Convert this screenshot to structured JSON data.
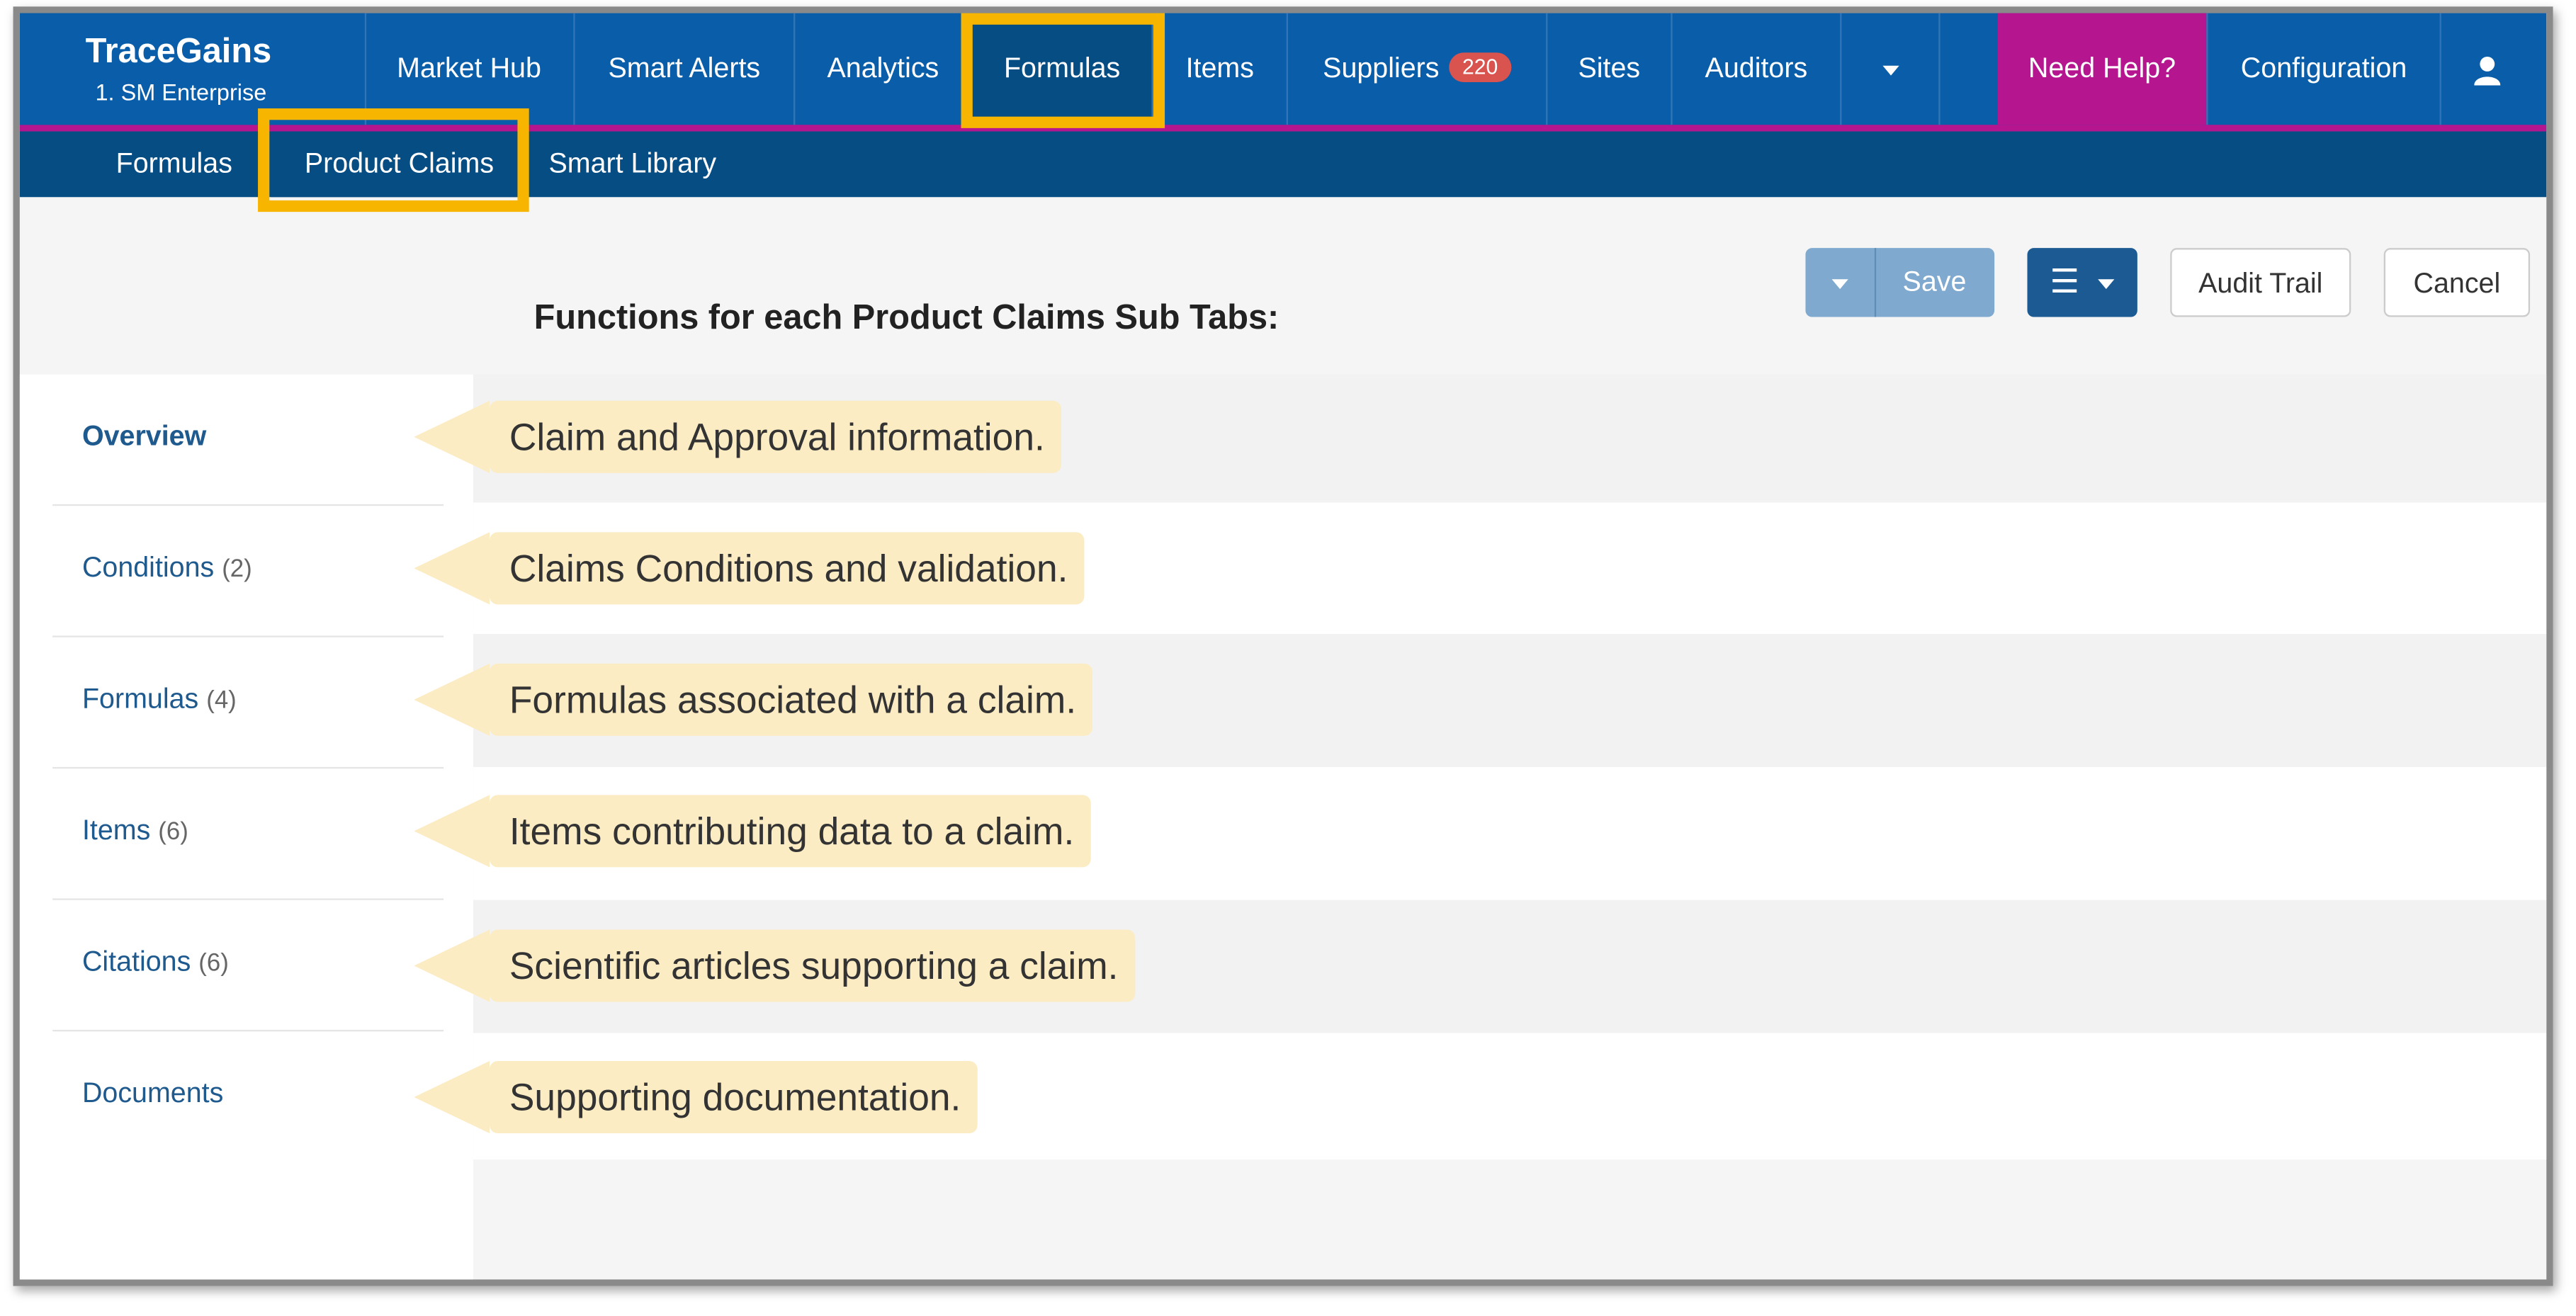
{
  "brand": {
    "name": "TraceGains",
    "subtitle": "1. SM Enterprise"
  },
  "nav": {
    "items": [
      {
        "label": "Market Hub"
      },
      {
        "label": "Smart Alerts"
      },
      {
        "label": "Analytics"
      },
      {
        "label": "Formulas"
      },
      {
        "label": "Items"
      },
      {
        "label": "Suppliers",
        "badge": "220"
      },
      {
        "label": "Sites"
      },
      {
        "label": "Auditors"
      }
    ],
    "help": "Need Help?",
    "configuration": "Configuration"
  },
  "subnav": {
    "items": [
      {
        "label": "Formulas"
      },
      {
        "label": "Product Claims"
      },
      {
        "label": "Smart Library"
      }
    ]
  },
  "heading": "Functions for each Product Claims Sub Tabs:",
  "toolbar": {
    "save": "Save",
    "audit": "Audit Trail",
    "cancel": "Cancel"
  },
  "tabs": [
    {
      "label": "Overview",
      "count": "",
      "desc": "Claim and Approval information."
    },
    {
      "label": "Conditions",
      "count": "(2)",
      "desc": "Claims Conditions and validation."
    },
    {
      "label": "Formulas",
      "count": "(4)",
      "desc": "Formulas associated with a claim."
    },
    {
      "label": "Items",
      "count": "(6)",
      "desc": "Items contributing data to a claim."
    },
    {
      "label": "Citations",
      "count": "(6)",
      "desc": "Scientific articles supporting a claim."
    },
    {
      "label": "Documents",
      "count": "",
      "desc": "Supporting documentation."
    }
  ],
  "colors": {
    "nav": "#0a5da8",
    "subnav": "#064d84",
    "accent": "#b5158f",
    "highlight": "#f7b500",
    "callout": "#fcecc4"
  }
}
